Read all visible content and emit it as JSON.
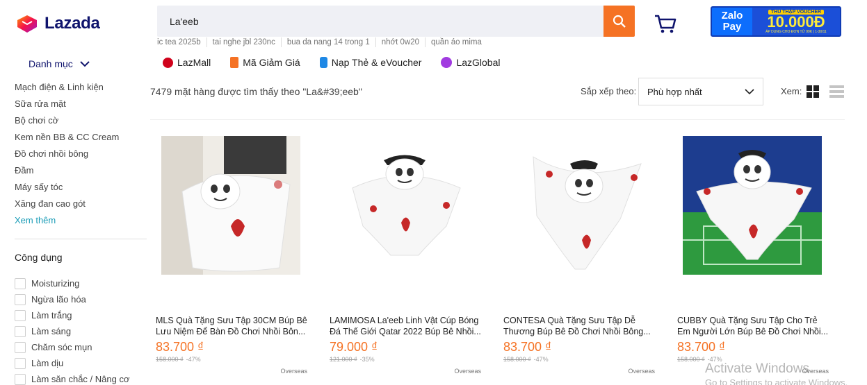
{
  "brand": {
    "name": "Lazada",
    "accent": "#f57224",
    "navy": "#0f146d"
  },
  "search": {
    "value": "La'eeb",
    "button_icon": "search-icon"
  },
  "suggestions": [
    "ic tea 2025b",
    "tai nghe jbl 230nc",
    "bua da nang 14 trong 1",
    "nhớt 0w20",
    "quần áo mima"
  ],
  "promo": {
    "left_line1": "Zalo",
    "left_line2": "Pay",
    "tag": "THU THẬP VOUCHER",
    "amount": "10.000Đ",
    "note": "ÁP DỤNG CHO ĐƠN TỪ 99K | 1-30/11"
  },
  "nav_links": [
    {
      "label": "LazMall",
      "icon": "lazmall-icon"
    },
    {
      "label": "Mã Giảm Giá",
      "icon": "voucher-icon"
    },
    {
      "label": "Nạp Thẻ & eVoucher",
      "icon": "topup-icon"
    },
    {
      "label": "LazGlobal",
      "icon": "global-icon"
    }
  ],
  "sidebar": {
    "category_title": "Danh mục",
    "categories": [
      "Mạch điện & Linh kiện",
      "Sữa rửa mặt",
      "Bộ chơi cờ",
      "Kem nền BB & CC Cream",
      "Đồ chơi nhồi bông",
      "Đầm",
      "Máy sấy tóc",
      "Xăng đan cao gót"
    ],
    "more_label": "Xem thêm",
    "usage_title": "Công dụng",
    "usage_options": [
      "Moisturizing",
      "Ngừa lão hóa",
      "Làm trắng",
      "Làm sáng",
      "Chăm sóc mụn",
      "Làm dịu",
      "Làm săn chắc / Nâng cơ"
    ]
  },
  "results": {
    "summary": "7479 mặt hàng được tìm thấy theo \"La&#39;eeb\"",
    "sort_label": "Sắp xếp theo:",
    "sort_value": "Phù hợp nhất",
    "view_label": "Xem:"
  },
  "products": [
    {
      "title": "MLS Quà Tặng Sưu Tập 30CM Búp Bê Lưu Niệm Để Bàn Đồ Chơi Nhồi Bôn...",
      "price": "83.700 ₫",
      "old_price": "158.000 ₫",
      "discount": "-47%",
      "origin": "Overseas"
    },
    {
      "title": "LAMIMOSA La'eeb Linh Vật Cúp Bóng Đá Thế Giới Qatar 2022 Búp Bê Nhồi...",
      "price": "79.000 ₫",
      "old_price": "121.000 ₫",
      "discount": "-35%",
      "origin": "Overseas"
    },
    {
      "title": "CONTESA Quà Tặng Sưu Tập Dễ Thương Búp Bê Đồ Chơi Nhồi Bông...",
      "price": "83.700 ₫",
      "old_price": "158.000 ₫",
      "discount": "-47%",
      "origin": "Overseas"
    },
    {
      "title": "CUBBY Quà Tặng Sưu Tập Cho Trẻ Em Người Lớn Búp Bê Đồ Chơi Nhồi...",
      "price": "83.700 ₫",
      "old_price": "158.000 ₫",
      "discount": "-47%",
      "origin": "Overseas"
    }
  ],
  "watermark": {
    "line1": "Activate Windows",
    "line2": "Go to Settings to activate Windows."
  }
}
